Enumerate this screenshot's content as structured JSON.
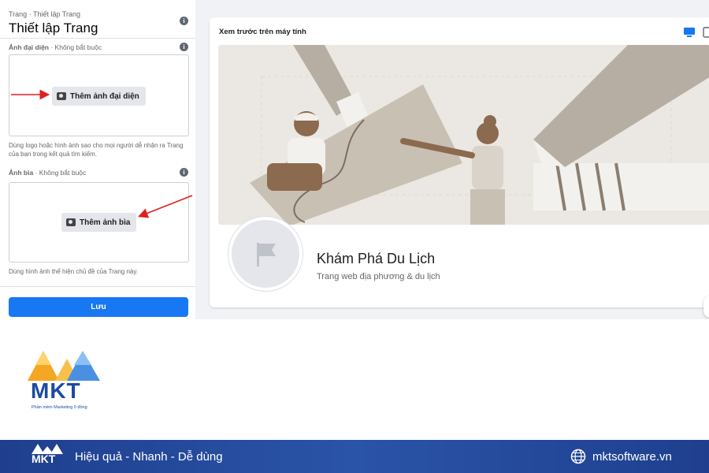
{
  "left_panel": {
    "breadcrumb": "Trang · Thiết lập Trang",
    "title": "Thiết lập Trang",
    "avatar_section": {
      "label_bold": "Ảnh đại diện",
      "label_rest": " · Không bắt buộc",
      "button": "Thêm ảnh đại diện",
      "help": "Dùng logo hoặc hình ảnh sao cho mọi người dễ nhận ra Trang của bạn trong kết quả tìm kiếm."
    },
    "cover_section": {
      "label_bold": "Ảnh bìa",
      "label_rest": " · Không bắt buộc",
      "button": "Thêm ảnh bìa",
      "help": "Dùng hình ảnh thể hiện chủ đề của Trang này."
    },
    "save_button": "Lưu"
  },
  "preview": {
    "title": "Xem trước trên máy tính",
    "page_name": "Khám Phá Du Lịch",
    "page_category": "Trang web địa phương & du lịch",
    "icons": [
      "desktop-icon",
      "mobile-icon",
      "flag-icon"
    ]
  },
  "branding": {
    "logo_text": "MKT",
    "logo_tagline": "Phần mềm Marketing 0 đồng",
    "slogan": "Hiệu quả - Nhanh - Dễ dùng",
    "website": "mktsoftware.vn",
    "colors": {
      "primary": "#1b4ba0",
      "accent": "#f5a623",
      "button": "#1877f2",
      "arrow": "#e02020"
    }
  }
}
